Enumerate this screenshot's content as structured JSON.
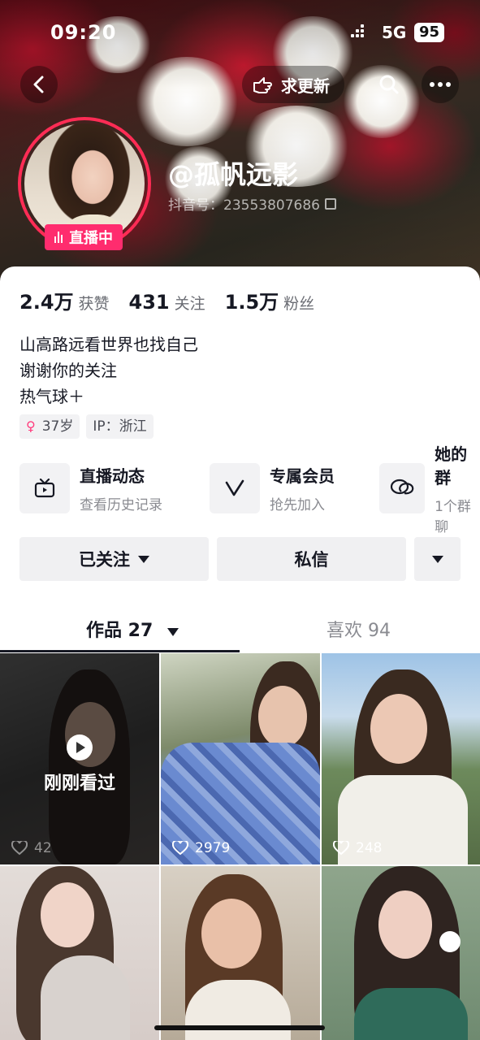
{
  "status_bar": {
    "time": "09:20",
    "network": "5G",
    "battery": "95"
  },
  "header": {
    "update_label": "求更新"
  },
  "profile": {
    "nickname": "@孤帆远影",
    "douyin_id": "抖音号：23553807686",
    "live_badge": "直播中",
    "stats": [
      {
        "number": "2.4万",
        "label": "获赞"
      },
      {
        "number": "431",
        "label": "关注"
      },
      {
        "number": "1.5万",
        "label": "粉丝"
      }
    ],
    "bio": [
      "山高路远看世界也找自己",
      "谢谢你的关注",
      "热气球＋"
    ],
    "tags": {
      "age": "37岁",
      "ip": "IP：浙江"
    }
  },
  "features": [
    {
      "title": "直播动态",
      "subtitle": "查看历史记录",
      "icon": "tv-icon"
    },
    {
      "title": "专属会员",
      "subtitle": "抢先加入",
      "icon": "v-icon"
    },
    {
      "title": "她的群",
      "subtitle": "1个群聊",
      "icon": "chat-bubbles-icon"
    }
  ],
  "actions": {
    "followed_label": "已关注",
    "message_label": "私信"
  },
  "tabs": {
    "works_label": "作品 27",
    "likes_label": "喜欢 94"
  },
  "videos": [
    {
      "likes": "42",
      "overlay": "刚刚看过"
    },
    {
      "likes": "2979"
    },
    {
      "likes": "248"
    },
    {
      "likes": ""
    },
    {
      "likes": ""
    },
    {
      "likes": ""
    }
  ],
  "colors": {
    "accent": "#ff2c55",
    "live_badge": "#ff2c6e",
    "text": "#161823"
  }
}
